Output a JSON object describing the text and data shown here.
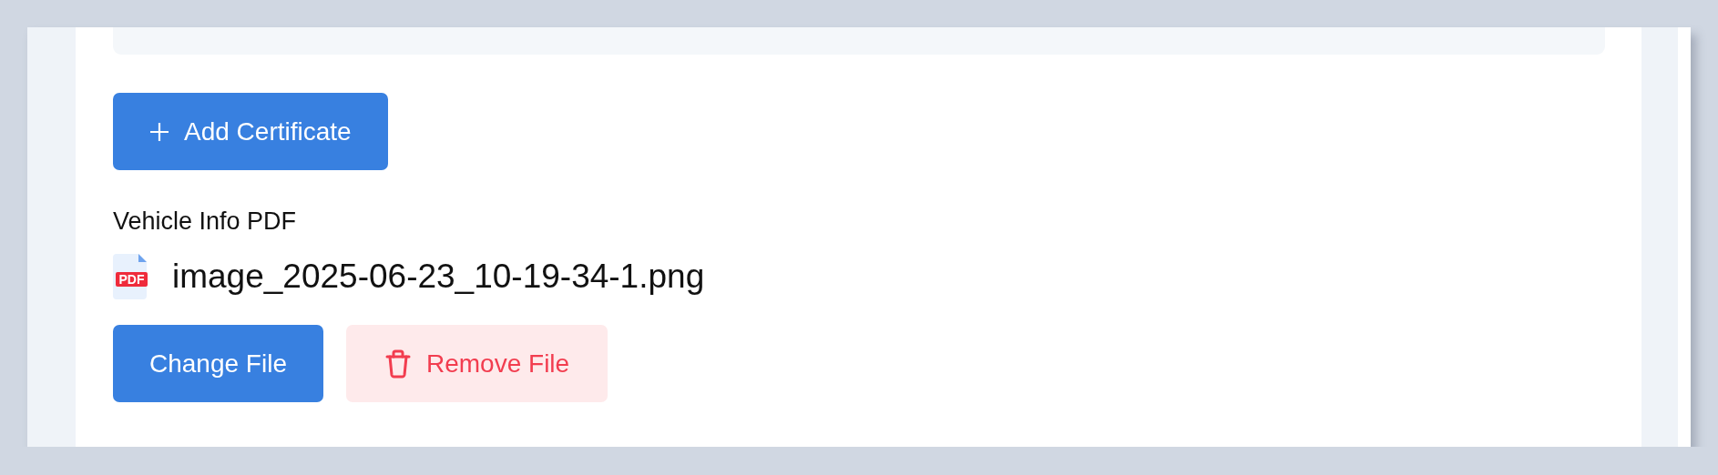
{
  "add_button": {
    "label": "Add Certificate"
  },
  "file_section": {
    "label": "Vehicle Info PDF",
    "file": {
      "badge": "PDF",
      "name": "image_2025-06-23_10-19-34-1.png"
    },
    "buttons": [
      {
        "kind": "primary",
        "label": "Change File"
      },
      {
        "kind": "danger",
        "label": "Remove File"
      }
    ]
  }
}
